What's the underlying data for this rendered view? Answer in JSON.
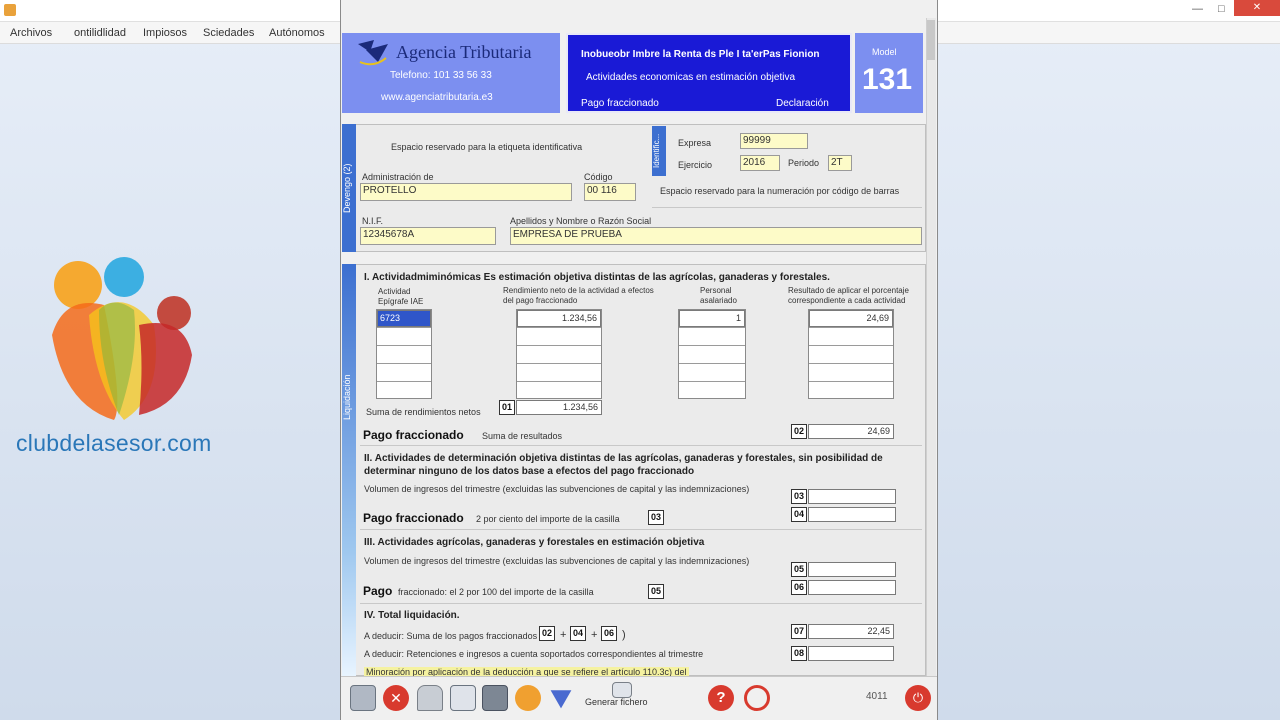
{
  "bg_app": {
    "menu": [
      "Archivos",
      "ontilidlidad",
      "Impiosos",
      "Sciedades",
      "Autónomos"
    ]
  },
  "logo": {
    "text": "clubdelasesor.com"
  },
  "header": {
    "agency_name": "Agencia Tributaria",
    "phone": "Telefono: 101 33 56 33",
    "website": "www.agenciatributaria.e3",
    "title_line1": "Inobueobr Imbre la Renta ds Ple I ta'erPas Fionion",
    "title_line2": "Actividades economicas en estimación objetiva",
    "pago_label": "Pago fraccionado",
    "declaracion_label": "Declaración",
    "modelo_label": "Model",
    "modelo_number": "131"
  },
  "devengo": {
    "tab_label": "Devengo (2)",
    "ident_tab_label": "Identific...",
    "etiqueta_label": "Espacio reservado para la etiqueta identificativa",
    "ejercicio_label": "Ejercicio",
    "ejercicio_value": "2016",
    "periodo_label": "Periodo",
    "periodo_value": "2T",
    "empresa_label": "Expresa",
    "empresa_value": "99999",
    "admin_label": "Administración de",
    "admin_value": "PROTELLO",
    "codigo_label": "Código",
    "codigo_value": "00 116",
    "barcode_label": "Espacio reservado para la numeración por código de barras",
    "nif_label": "N.I.F.",
    "nif_value": "12345678A",
    "razon_label": "Apellidos y Nombre o Razón Social",
    "razon_value": "EMPRESA DE PRUEBA"
  },
  "liquidacion": {
    "tab_label": "Liquidación",
    "sec1_title": "I. Actividadmiminómicas Es estimación objetiva distintas de las agrícolas, ganaderas y forestales.",
    "col_actividad": "Actividad",
    "col_epigrafe": "Epígrafe IAE",
    "col_rendimiento": "Rendimiento neto de la actividad a efectos del pago fraccionado",
    "col_personal": "Personal asalariado",
    "col_resultado": "Resultado de aplicar el porcentaje correspondiente a cada actividad",
    "row1_epigrafe": "6723",
    "row1_rendimiento": "1.234,56",
    "row1_personal": "1",
    "row1_resultado": "24,69",
    "suma_label": "Suma de rendimientos netos",
    "casilla_01": "01",
    "casilla_01_value": "1.234,56",
    "pago_label_1": "Pago fraccionado",
    "pago_desc_1": "Suma de resultados",
    "casilla_02": "02",
    "casilla_02_value": "24,69",
    "sec2_title": "II. Actividades de determinación objetiva distintas de las agrícolas, ganaderas y forestales, sin posibilidad de determinar ninguno de los datos base a efectos del pago fraccionado",
    "sec2_vol": "Volumen de ingresos del trimestre (excluidas las subvenciones de capital y las indemnizaciones)",
    "casilla_03": "03",
    "pago_label_2": "Pago fraccionado",
    "pago_desc_2": "2 por ciento del importe de la casilla",
    "casilla_04": "04",
    "casilla_03_ref": "03",
    "sec3_title": "III. Actividades agrícolas, ganaderas y forestales en estimación objetiva",
    "sec3_vol": "Volumen de ingresos del trimestre (excluidas las subvenciones de capital y las indemnizaciones)",
    "casilla_05": "05",
    "pago_label_3": "Pago",
    "pago_desc_3": "fraccionado: el 2 por 100 del importe de la casilla",
    "casilla_05_ref": "05",
    "casilla_06": "06",
    "sec4_title": "IV. Total liquidación.",
    "total_a_deducir": "A deducir: Suma de los pagos fraccionados (",
    "c02": "02",
    "c04": "04",
    "c06": "06",
    "casilla_07": "07",
    "casilla_07_value": "22,45",
    "retenciones_label": "A deducir: Retenciones e ingresos a cuenta soportados correspondientes al trimestre",
    "casilla_08": "08",
    "minoracion_label": "Minoración por aplicación de la deducción a que se refiere el artículo 110.3c) del"
  },
  "toolbar": {
    "generar_label": "Generar fichero",
    "count_label": "4011"
  },
  "colors": {
    "accent": "#1a1ad6",
    "header_light": "#7c8ff0",
    "field_yellow": "#fdfbc8",
    "tab_blue": "#3c6fd0"
  }
}
